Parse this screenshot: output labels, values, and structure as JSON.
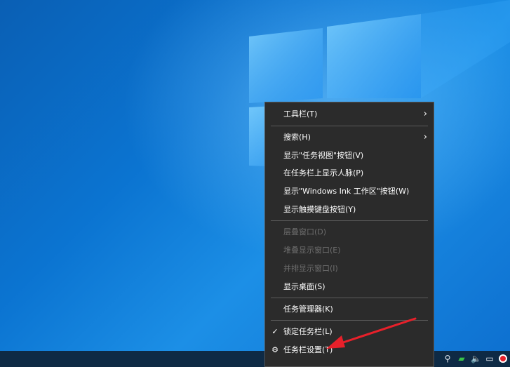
{
  "context_menu": {
    "items": [
      {
        "label": "工具栏(T)",
        "submenu": true,
        "enabled": true
      },
      {
        "label": "搜索(H)",
        "submenu": true,
        "enabled": true
      },
      {
        "label": "显示\"任务视图\"按钮(V)",
        "enabled": true
      },
      {
        "label": "在任务栏上显示人脉(P)",
        "enabled": true
      },
      {
        "label": "显示\"Windows Ink 工作区\"按钮(W)",
        "enabled": true
      },
      {
        "label": "显示触摸键盘按钮(Y)",
        "enabled": true
      },
      {
        "label": "层叠窗口(D)",
        "enabled": false
      },
      {
        "label": "堆叠显示窗口(E)",
        "enabled": false
      },
      {
        "label": "并排显示窗口(I)",
        "enabled": false
      },
      {
        "label": "显示桌面(S)",
        "enabled": true
      },
      {
        "label": "任务管理器(K)",
        "enabled": true
      },
      {
        "label": "锁定任务栏(L)",
        "enabled": true,
        "checked": true
      },
      {
        "label": "任务栏设置(T)",
        "enabled": true,
        "icon": "gear-icon"
      }
    ]
  },
  "annotation": {
    "color": "#e8202a"
  },
  "taskbar": {
    "tray_icons": [
      "network-icon",
      "nvidia-icon",
      "volume-icon",
      "display-icon",
      "record-icon"
    ]
  }
}
